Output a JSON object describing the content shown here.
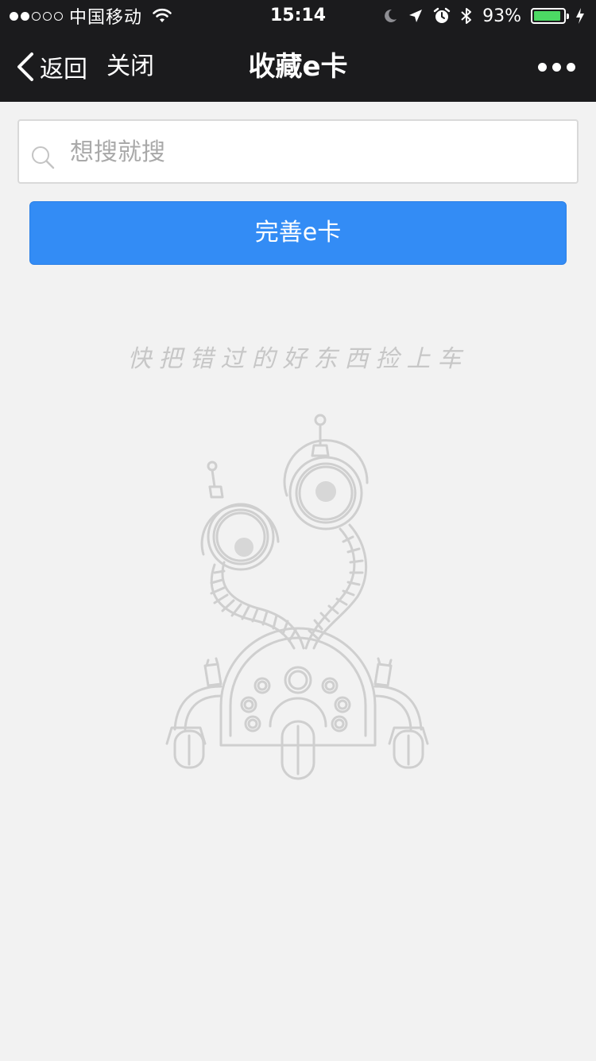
{
  "status_bar": {
    "carrier": "中国移动",
    "time": "15:14",
    "battery_percent": "93%",
    "battery_level": 0.93,
    "battery_color": "#4cd964",
    "signal_bars_filled": 2,
    "signal_bars_total": 5
  },
  "nav": {
    "back_label": "返回",
    "close_label": "关闭",
    "title": "收藏e卡"
  },
  "search": {
    "placeholder": "想搜就搜",
    "value": ""
  },
  "actions": {
    "complete_card_label": "完善e卡",
    "accent_color": "#338cf5"
  },
  "empty_state": {
    "message": "快把错过的好东西捡上车",
    "illustration": "robot-illustration"
  },
  "icons": {
    "wifi": "wifi-icon",
    "moon": "moon-icon",
    "location": "location-arrow-icon",
    "alarm": "alarm-icon",
    "bluetooth": "bluetooth-icon",
    "charging": "charging-bolt-icon",
    "back": "chevron-left-icon",
    "more": "more-dots-icon",
    "search": "search-icon"
  }
}
